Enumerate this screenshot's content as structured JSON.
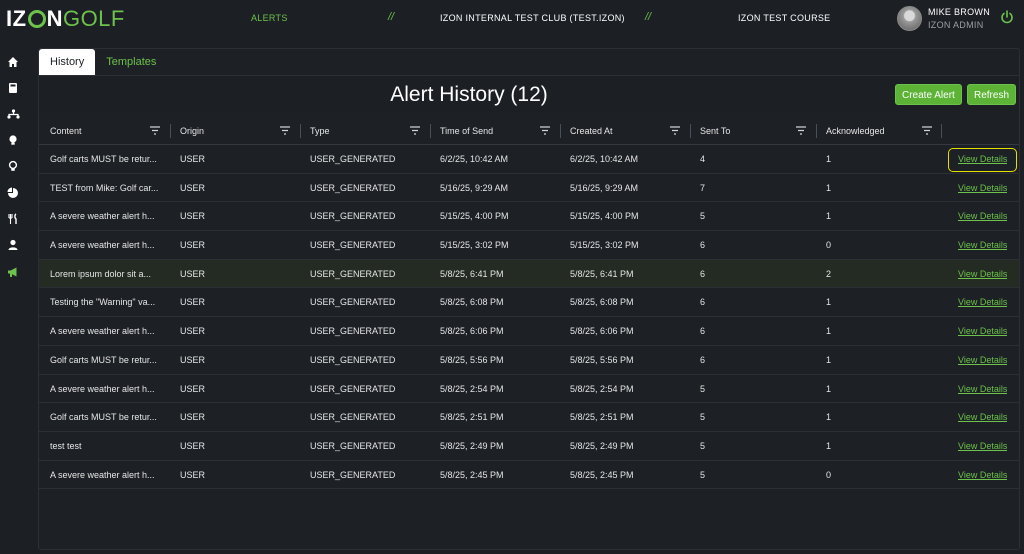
{
  "brand": {
    "logo_part1": "IZ",
    "logo_part2": "N",
    "logo_part3": "GOLF"
  },
  "nav": {
    "alerts_label": "ALERTS",
    "separator": "//",
    "club": "IZON INTERNAL TEST CLUB (TEST.IZON)",
    "course": "IZON TEST COURSE"
  },
  "user": {
    "name": "MIKE BROWN",
    "role": "IZON ADMIN"
  },
  "sidebar": {
    "icons": [
      "home-icon",
      "book-icon",
      "network-icon",
      "bulb-icon",
      "bulb-outline-icon",
      "pie-chart-icon",
      "utensils-icon",
      "user-icon",
      "megaphone-icon"
    ]
  },
  "tabs": {
    "history": "History",
    "templates": "Templates"
  },
  "page": {
    "title": "Alert History (12)"
  },
  "buttons": {
    "create": "Create Alert",
    "refresh": "Refresh"
  },
  "table": {
    "headers": {
      "content": "Content",
      "origin": "Origin",
      "type": "Type",
      "time_of_send": "Time of Send",
      "created_at": "Created At",
      "sent_to": "Sent To",
      "acknowledged": "Acknowledged"
    },
    "action_label": "View Details",
    "rows": [
      {
        "content": "Golf carts MUST be retur...",
        "origin": "USER",
        "type": "USER_GENERATED",
        "time": "6/2/25, 10:42 AM",
        "created": "6/2/25, 10:42 AM",
        "sent": "4",
        "ack": "1"
      },
      {
        "content": "TEST from Mike: Golf car...",
        "origin": "USER",
        "type": "USER_GENERATED",
        "time": "5/16/25, 9:29 AM",
        "created": "5/16/25, 9:29 AM",
        "sent": "7",
        "ack": "1"
      },
      {
        "content": "A severe weather alert h...",
        "origin": "USER",
        "type": "USER_GENERATED",
        "time": "5/15/25, 4:00 PM",
        "created": "5/15/25, 4:00 PM",
        "sent": "5",
        "ack": "1"
      },
      {
        "content": "A severe weather alert h...",
        "origin": "USER",
        "type": "USER_GENERATED",
        "time": "5/15/25, 3:02 PM",
        "created": "5/15/25, 3:02 PM",
        "sent": "6",
        "ack": "0"
      },
      {
        "content": "Lorem ipsum dolor sit a...",
        "origin": "USER",
        "type": "USER_GENERATED",
        "time": "5/8/25, 6:41 PM",
        "created": "5/8/25, 6:41 PM",
        "sent": "6",
        "ack": "2"
      },
      {
        "content": "Testing the \"Warning\" va...",
        "origin": "USER",
        "type": "USER_GENERATED",
        "time": "5/8/25, 6:08 PM",
        "created": "5/8/25, 6:08 PM",
        "sent": "6",
        "ack": "1"
      },
      {
        "content": "A severe weather alert h...",
        "origin": "USER",
        "type": "USER_GENERATED",
        "time": "5/8/25, 6:06 PM",
        "created": "5/8/25, 6:06 PM",
        "sent": "6",
        "ack": "1"
      },
      {
        "content": "Golf carts MUST be retur...",
        "origin": "USER",
        "type": "USER_GENERATED",
        "time": "5/8/25, 5:56 PM",
        "created": "5/8/25, 5:56 PM",
        "sent": "6",
        "ack": "1"
      },
      {
        "content": "A severe weather alert h...",
        "origin": "USER",
        "type": "USER_GENERATED",
        "time": "5/8/25, 2:54 PM",
        "created": "5/8/25, 2:54 PM",
        "sent": "5",
        "ack": "1"
      },
      {
        "content": "Golf carts MUST be retur...",
        "origin": "USER",
        "type": "USER_GENERATED",
        "time": "5/8/25, 2:51 PM",
        "created": "5/8/25, 2:51 PM",
        "sent": "5",
        "ack": "1"
      },
      {
        "content": "test test",
        "origin": "USER",
        "type": "USER_GENERATED",
        "time": "5/8/25, 2:49 PM",
        "created": "5/8/25, 2:49 PM",
        "sent": "5",
        "ack": "1"
      },
      {
        "content": "A severe weather alert h...",
        "origin": "USER",
        "type": "USER_GENERATED",
        "time": "5/8/25, 2:45 PM",
        "created": "5/8/25, 2:45 PM",
        "sent": "5",
        "ack": "0"
      }
    ]
  },
  "colors": {
    "accent": "#6cc24a",
    "background": "#1c1f24",
    "focus_outline": "#e4e000",
    "highlight_row": "#232b23"
  }
}
